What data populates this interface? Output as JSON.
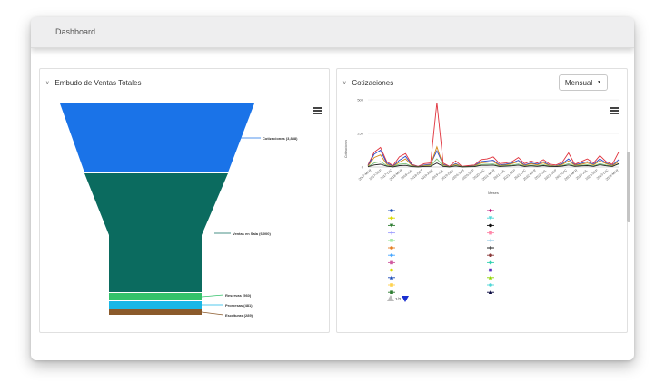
{
  "header": {
    "title": "Dashboard"
  },
  "funnel_panel": {
    "title": "Embudo de Ventas Totales",
    "labels": [
      "Cotizaciones (3,888)",
      "Ventas en Sala (6,000)",
      "Reservas (560)",
      "Promesas (481)",
      "Escrituras (289)"
    ]
  },
  "quotes_panel": {
    "title": "Cotizaciones",
    "period_select": "Mensual",
    "pager_text": "1/2"
  },
  "chart_data": [
    {
      "type": "funnel",
      "stages": [
        {
          "name": "Cotizaciones",
          "value": 3888,
          "color": "#1a73e8"
        },
        {
          "name": "Ventas en Sala",
          "value": 6000,
          "color": "#0b6b5f"
        },
        {
          "name": "Reservas",
          "value": 560,
          "color": "#33c26a"
        },
        {
          "name": "Promesas",
          "value": 481,
          "color": "#1ab7e6"
        },
        {
          "name": "Escrituras",
          "value": 289,
          "color": "#8b5a2b"
        }
      ]
    },
    {
      "type": "line",
      "ylabel": "Cotizaciones",
      "xlabel": "Meses",
      "yticks": [
        "0",
        "250",
        "500"
      ],
      "ylim": [
        0,
        500
      ],
      "categories": [
        "2017-MAR",
        "2017-SEP",
        "2017-DIC",
        "2018-MAR",
        "2018-JUL",
        "2018-OCT",
        "2019-ABR",
        "2019-JUL",
        "2019-OCT",
        "2020-JUN",
        "2020-SEP",
        "2020-DIC",
        "2021-MAR",
        "2021-JUL",
        "2021-SEP",
        "2021-DIC",
        "2022-MAR",
        "2022-JUL",
        "2022-SEP",
        "2022-DIC",
        "2023-MAR",
        "2023-JUL",
        "2023-SEP",
        "2023-DIC",
        "2024-MAR"
      ],
      "series": [
        {
          "color": "#e0323c",
          "values": [
            15,
            110,
            145,
            40,
            10,
            75,
            100,
            20,
            5,
            25,
            30,
            480,
            30,
            5,
            45,
            5,
            10,
            15,
            55,
            60,
            75,
            25,
            30,
            40,
            70,
            25,
            45,
            30,
            55,
            20,
            15,
            35,
            105,
            20,
            40,
            60,
            30,
            85,
            40,
            20,
            110
          ]
        },
        {
          "color": "#2a49c9",
          "values": [
            8,
            95,
            125,
            30,
            5,
            50,
            80,
            15,
            3,
            15,
            20,
            120,
            20,
            3,
            25,
            3,
            5,
            10,
            40,
            45,
            50,
            15,
            20,
            30,
            50,
            15,
            30,
            20,
            40,
            12,
            8,
            25,
            60,
            15,
            28,
            40,
            20,
            60,
            30,
            12,
            55
          ]
        },
        {
          "color": "#d58a1a",
          "values": [
            5,
            70,
            90,
            20,
            3,
            35,
            60,
            10,
            2,
            10,
            15,
            150,
            15,
            2,
            20,
            2,
            4,
            8,
            30,
            35,
            40,
            10,
            15,
            25,
            40,
            10,
            25,
            15,
            30,
            10,
            6,
            18,
            45,
            12,
            20,
            30,
            15,
            45,
            25,
            10,
            40
          ]
        },
        {
          "color": "#7cc47a",
          "values": [
            3,
            30,
            40,
            10,
            2,
            20,
            25,
            5,
            1,
            6,
            8,
            60,
            8,
            1,
            12,
            1,
            2,
            5,
            18,
            20,
            22,
            6,
            10,
            14,
            22,
            6,
            14,
            8,
            16,
            6,
            4,
            10,
            25,
            7,
            12,
            16,
            8,
            24,
            14,
            6,
            20
          ]
        },
        {
          "color": "#222222",
          "values": [
            2,
            15,
            20,
            6,
            1,
            10,
            12,
            3,
            1,
            4,
            5,
            30,
            5,
            1,
            8,
            1,
            2,
            3,
            12,
            12,
            14,
            4,
            6,
            9,
            14,
            4,
            9,
            5,
            10,
            4,
            3,
            7,
            15,
            5,
            8,
            10,
            5,
            16,
            9,
            4,
            25
          ]
        }
      ],
      "legend_left": [
        {
          "color": "#1f4fb8",
          "symbol": "circle"
        },
        {
          "color": "#d9d900",
          "symbol": "diamond"
        },
        {
          "color": "#2e7d32",
          "symbol": "triangle-down"
        },
        {
          "color": "#a0a0ff",
          "symbol": "cross"
        },
        {
          "color": "#a7e8a7",
          "symbol": "square"
        },
        {
          "color": "#e67e22",
          "symbol": "circle"
        },
        {
          "color": "#4aa8ff",
          "symbol": "diamond"
        },
        {
          "color": "#d05aa0",
          "symbol": "square"
        },
        {
          "color": "#d9d900",
          "symbol": "circle"
        },
        {
          "color": "#1f4fb8",
          "symbol": "triangle"
        },
        {
          "color": "#ffd24d",
          "symbol": "square"
        },
        {
          "color": "#2e7d32",
          "symbol": "square"
        }
      ],
      "legend_right": [
        {
          "color": "#c0157a",
          "symbol": "diamond"
        },
        {
          "color": "#4dd6d6",
          "symbol": "triangle-down"
        },
        {
          "color": "#111111",
          "symbol": "circle"
        },
        {
          "color": "#ff88aa",
          "symbol": "square"
        },
        {
          "color": "#9ecfe8",
          "symbol": "cross"
        },
        {
          "color": "#111111",
          "symbol": "cross"
        },
        {
          "color": "#8b3a3a",
          "symbol": "circle"
        },
        {
          "color": "#33d1b0",
          "symbol": "diamond"
        },
        {
          "color": "#5a2ebf",
          "symbol": "square"
        },
        {
          "color": "#8fd400",
          "symbol": "triangle"
        },
        {
          "color": "#4dd6d6",
          "symbol": "circle"
        },
        {
          "color": "#0a0a40",
          "symbol": "triangle"
        }
      ]
    }
  ]
}
